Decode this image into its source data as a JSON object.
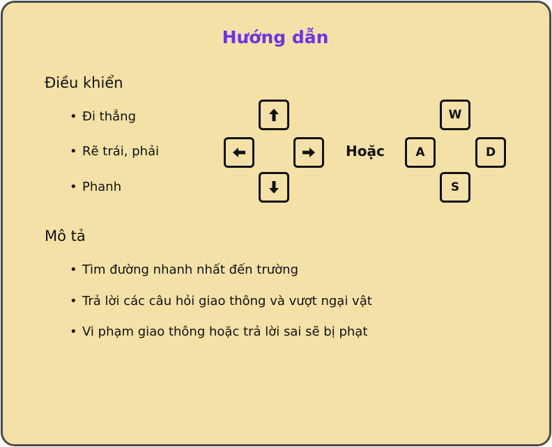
{
  "title": "Hướng dẫn",
  "controls": {
    "heading": "Điều khiển",
    "items": [
      "Đi thẳng",
      "Rẽ trái, phải",
      "Phanh"
    ],
    "or_label": "Hoặc",
    "wasd": {
      "w": "W",
      "a": "A",
      "s": "S",
      "d": "D"
    }
  },
  "description": {
    "heading": "Mô tả",
    "items": [
      "Tìm đường nhanh nhất đến trường",
      "Trả lời các câu hỏi giao thông và vượt ngại vật",
      "Vi phạm giao thông hoặc trả lời sai sẽ bị phạt"
    ]
  }
}
